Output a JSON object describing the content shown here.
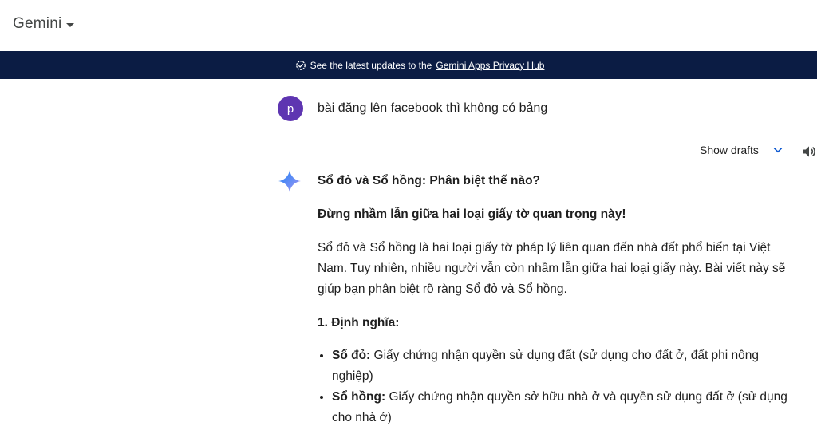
{
  "app": {
    "title": "Gemini"
  },
  "banner": {
    "prefix": "See the latest updates to the",
    "link": "Gemini Apps Privacy Hub"
  },
  "user": {
    "avatar_letter": "p",
    "message": "bài đăng lên facebook thì không có bảng"
  },
  "response_controls": {
    "show_drafts": "Show drafts"
  },
  "response": {
    "title": "Sổ đỏ và Sổ hồng: Phân biệt thế nào?",
    "subtitle": "Đừng nhầm lẫn giữa hai loại giấy tờ quan trọng này!",
    "intro": "Sổ đỏ và Sổ hồng là hai loại giấy tờ pháp lý liên quan đến nhà đất phổ biến tại Việt Nam. Tuy nhiên, nhiều người vẫn còn nhầm lẫn giữa hai loại giấy này. Bài viết này sẽ giúp bạn phân biệt rõ ràng Sổ đỏ và Sổ hồng.",
    "section1": "1. Định nghĩa:",
    "items": [
      {
        "term": "Sổ đỏ:",
        "text": " Giấy chứng nhận quyền sử dụng đất (sử dụng cho đất ở, đất phi nông nghiệp)"
      },
      {
        "term": "Sổ hồng:",
        "text": " Giấy chứng nhận quyền sở hữu nhà ở và quyền sử dụng đất ở (sử dụng cho nhà ở)"
      }
    ]
  },
  "colors": {
    "banner_bg": "#0b1c44",
    "avatar_bg": "#5e35b1",
    "accent": "#0b57d0"
  },
  "icons": [
    "caret-down-icon",
    "check-circle-icon",
    "chevron-down-icon",
    "speaker-icon",
    "gemini-star-icon"
  ]
}
